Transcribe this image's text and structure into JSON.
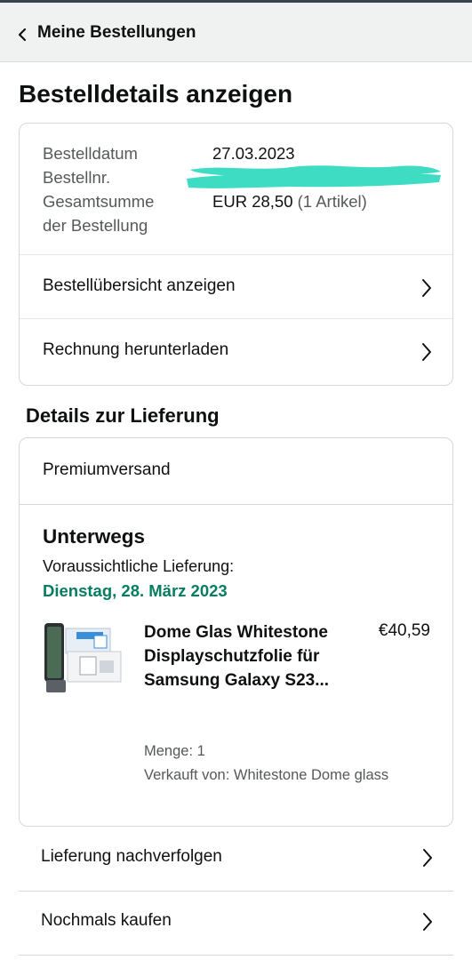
{
  "header": {
    "back_label": "Meine Bestellungen"
  },
  "page_title": "Bestelldetails anzeigen",
  "order_info": {
    "date_label": "Bestelldatum",
    "date_value": "27.03.2023",
    "number_label": "Bestellnr.",
    "total_label_line1": "Gesamtsumme",
    "total_label_line2": "der Bestellung",
    "total_value": "EUR 28,50",
    "total_items": "(1 Artikel)"
  },
  "order_links": [
    {
      "label": "Bestellübersicht anzeigen"
    },
    {
      "label": "Rechnung herunterladen"
    }
  ],
  "delivery": {
    "section_title": "Details zur Lieferung",
    "shipping_method": "Premiumversand",
    "status": "Unterwegs",
    "expected_label": "Voraussichtliche Lieferung:",
    "expected_date": "Dienstag, 28. März 2023",
    "product": {
      "title": "Dome Glas Whitestone Displayschutzfolie für Samsung Galaxy S23...",
      "price": "€40,59",
      "quantity": "Menge: 1",
      "seller": "Verkauft von: Whitestone Dome glass"
    }
  },
  "actions": [
    {
      "label": "Lieferung nachverfolgen"
    },
    {
      "label": "Nochmals kaufen"
    }
  ],
  "colors": {
    "delivery_date": "#067d62",
    "redaction": "#3fdcc4",
    "header_bg": "#f0f2f2"
  },
  "icons": {
    "back": "chevron-left-icon",
    "row_arrow": "chevron-right-icon"
  }
}
